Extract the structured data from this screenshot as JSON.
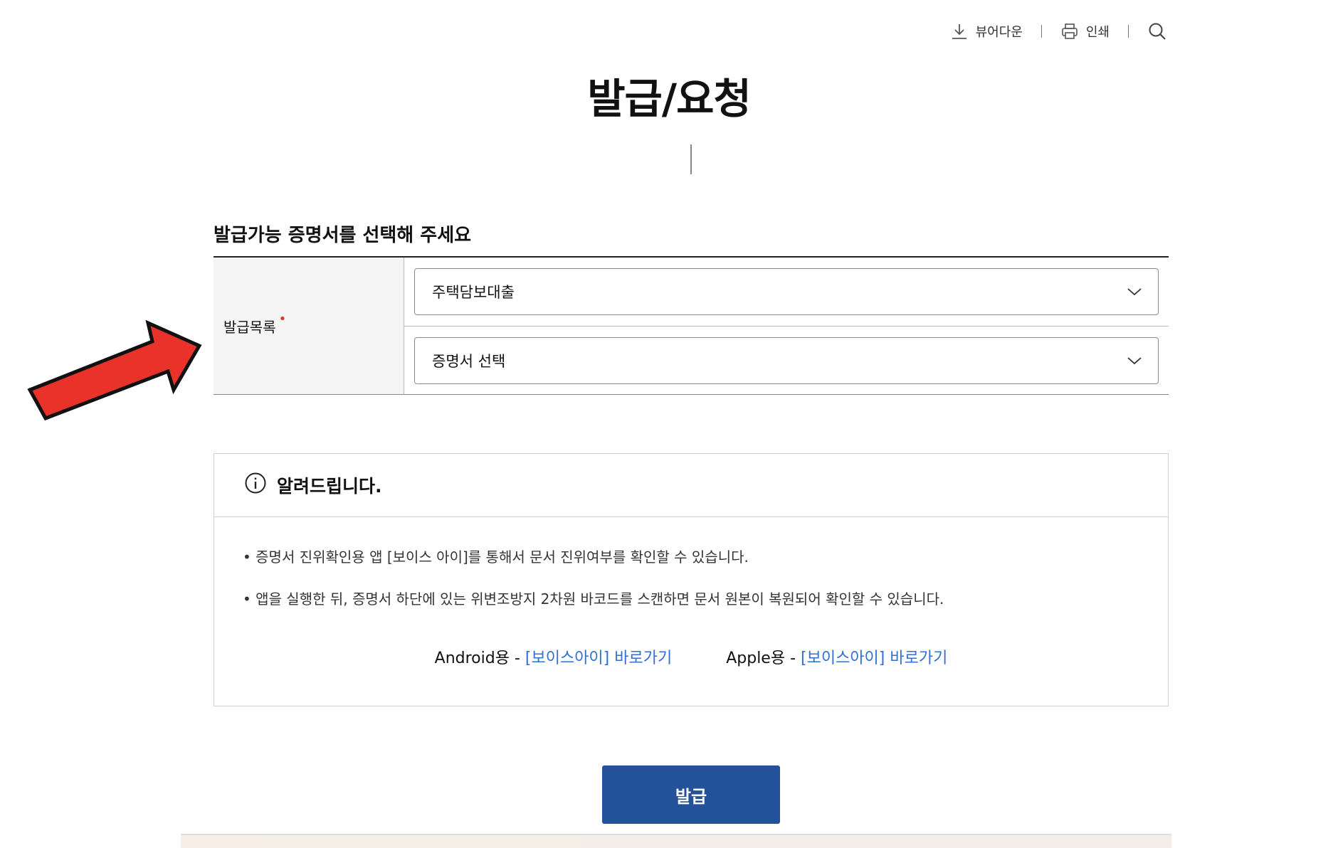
{
  "toolbar": {
    "viewer_download_label": "뷰어다운",
    "print_label": "인쇄"
  },
  "page": {
    "title": "발급/요청"
  },
  "form": {
    "heading": "발급가능 증명서를 선택해 주세요",
    "field_label": "발급목록",
    "required_marker": "•",
    "category_select_value": "주택담보대출",
    "certificate_select_value": "증명서 선택"
  },
  "notice": {
    "title": "알려드립니다.",
    "lines": [
      "• 증명서 진위확인용 앱 [보이스 아이]를 통해서 문서 진위여부를 확인할 수 있습니다.",
      "• 앱을 실행한 뒤, 증명서 하단에 있는 위변조방지 2차원 바코드를 스캔하면 문서 원본이 복원되어 확인할 수 있습니다."
    ],
    "android_label": "Android용 - ",
    "android_link": "[보이스아이] 바로가기",
    "apple_label": "Apple용 - ",
    "apple_link": "[보이스아이] 바로가기"
  },
  "actions": {
    "issue_label": "발급"
  },
  "colors": {
    "primary_button": "#23529b",
    "link": "#2f6fd6",
    "required": "#d93636",
    "annotation_arrow": "#e8322a"
  },
  "icons": {
    "download": "download-icon",
    "print": "printer-icon",
    "search": "search-icon",
    "dropdown": "chevron-down-icon",
    "info": "info-icon",
    "annotation": "red-arrow-icon"
  }
}
